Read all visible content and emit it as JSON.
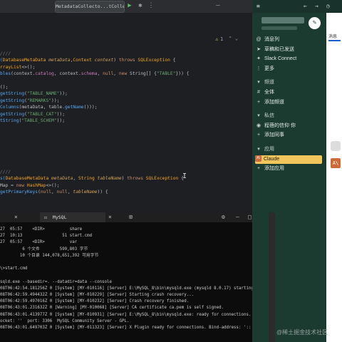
{
  "ide": {
    "tab_title": "MetadataCollecto...tCollect",
    "warnings": "1",
    "code_lines": [
      {
        "parts": [
          [
            "cm",
            "////"
          ]
        ]
      },
      {
        "parts": [
          [
            "fn",
            "("
          ],
          [
            "ty",
            "DatabaseMetaData "
          ],
          [
            "pa",
            "metaData"
          ],
          [
            "",
            ","
          ],
          [
            "ty",
            "Context "
          ],
          [
            "pa",
            "context"
          ],
          [
            "",
            ") "
          ],
          [
            "kw",
            "throws "
          ],
          [
            "ty",
            "SQLException "
          ],
          [
            "",
            "{"
          ]
        ]
      },
      {
        "parts": [
          [
            "ty",
            "rrayList"
          ],
          [
            "",
            "<>();"
          ]
        ]
      },
      {
        "parts": [
          [
            "fn",
            "bles"
          ],
          [
            "",
            "(context."
          ],
          [
            "fi",
            "catalog"
          ],
          [
            "",
            ", context."
          ],
          [
            "fi",
            "schema"
          ],
          [
            "",
            ", "
          ],
          [
            "kw",
            "null"
          ],
          [
            "",
            ", "
          ],
          [
            "kw",
            "new "
          ],
          [
            "",
            "String[] {"
          ],
          [
            "st",
            "\"TABLE\""
          ],
          [
            "",
            "})) {"
          ]
        ]
      },
      {
        "parts": [
          [
            "",
            ""
          ]
        ]
      },
      {
        "parts": [
          [
            "",
            "();"
          ]
        ]
      },
      {
        "parts": [
          [
            "fn",
            "getString"
          ],
          [
            "",
            "("
          ],
          [
            "st",
            "\"TABLE_NAME\""
          ],
          [
            "",
            "));"
          ]
        ]
      },
      {
        "parts": [
          [
            "fn",
            "getString"
          ],
          [
            "",
            "("
          ],
          [
            "st",
            "\"REMARKS\""
          ],
          [
            "",
            "));"
          ]
        ]
      },
      {
        "parts": [
          [
            "fn",
            "Columns"
          ],
          [
            "",
            "(metaData, table."
          ],
          [
            "fn",
            "getName"
          ],
          [
            "",
            "()));"
          ]
        ]
      },
      {
        "parts": [
          [
            "fn",
            "getString"
          ],
          [
            "",
            "("
          ],
          [
            "st",
            "\"TABLE_CAT\""
          ],
          [
            "",
            "));"
          ]
        ]
      },
      {
        "parts": [
          [
            "fn",
            "tString"
          ],
          [
            "",
            "("
          ],
          [
            "st",
            "\"TABLE_SCHEM\""
          ],
          [
            "",
            "));"
          ]
        ]
      }
    ],
    "code_lines_2": [
      {
        "parts": [
          [
            "cm",
            "////"
          ]
        ]
      },
      {
        "parts": [
          [
            "fn",
            "s("
          ],
          [
            "ty",
            "DatabaseMetaData "
          ],
          [
            "pa",
            "metaData"
          ],
          [
            "",
            ", "
          ],
          [
            "ty",
            "String "
          ],
          [
            "pa",
            "tableName"
          ],
          [
            "",
            ") "
          ],
          [
            "kw",
            "throws "
          ],
          [
            "ty",
            "SQLException "
          ],
          [
            "",
            "{"
          ]
        ]
      },
      {
        "parts": [
          [
            "",
            "Map = "
          ],
          [
            "kw",
            "new "
          ],
          [
            "ty",
            "HashMap"
          ],
          [
            "",
            "<>();"
          ]
        ]
      },
      {
        "parts": [
          [
            "fn",
            "getPrimaryKeys"
          ],
          [
            "",
            "("
          ],
          [
            "kw",
            "null"
          ],
          [
            "",
            ", "
          ],
          [
            "kw",
            "null"
          ],
          [
            "",
            ", "
          ],
          [
            "pa",
            "tableName"
          ],
          [
            "",
            ")) {"
          ]
        ]
      }
    ]
  },
  "terminal": {
    "tab_label": "MySQL",
    "lines": [
      "27  05:57    <DIR>          share",
      "27  10:13                51 start.cmd",
      "27  05:57    <DIR>          var",
      "         6 个文件        599,803 字节",
      "        10 个目录 144,078,651,392 可用字节",
      "",
      "\\>start.cmd",
      "",
      "sqld.exe --basedir=. --datadir=data --console",
      "08T06:42:54.181256Z 0 [System] [MY-010116] [Server] E:\\MySQL_8\\bin\\mysqld.exe (mysqld 8.0.17) starting as process",
      "08T06:42:59.494432Z 0 [System] [MY-010229] [Server] Starting crash recovery...",
      "08T06:42:59.497016Z 0 [System] [MY-010232] [Server] Crash recovery finished.",
      "08T06:43:01.231632Z 0 [Warning] [MY-010068] [Server] CA certificate ca.pem is self signed.",
      "08T06:43:01.413977Z 0 [System] [MY-010931] [Server] E:\\MySQL_8\\bin\\mysqld.exe: ready for connections. Version: '8.",
      "ocket: ''  port: 3306  MySQL Community Server - GPL.",
      "08T06:43:01.649703Z 0 [System] [MY-011323] [Server] X Plugin ready for connections. Bind-address: '::' port: 33060"
    ]
  },
  "chat": {
    "sidebar": {
      "items_top": [
        {
          "icon": "@",
          "label": "消息列"
        },
        {
          "icon": "➤",
          "label": "草稿和已发送"
        },
        {
          "icon": "✦",
          "label": "Slack Connect"
        },
        {
          "icon": "⋮",
          "label": "更多"
        }
      ],
      "channels_header": "频道",
      "channels": [
        {
          "icon": "#",
          "label": "全体"
        },
        {
          "icon": "+",
          "label": "添加频道"
        }
      ],
      "dm_header": "私信",
      "dms": [
        {
          "icon": "◉",
          "label": "程蓓的信仰 你"
        },
        {
          "icon": "+",
          "label": "添加同事"
        }
      ],
      "apps_header": "应用",
      "apps": [
        {
          "icon": "A\\",
          "label": "Claude"
        },
        {
          "icon": "+",
          "label": "添加应用"
        }
      ]
    },
    "main_tab": "消息"
  },
  "watermark": "@稀土掘金技术社区"
}
